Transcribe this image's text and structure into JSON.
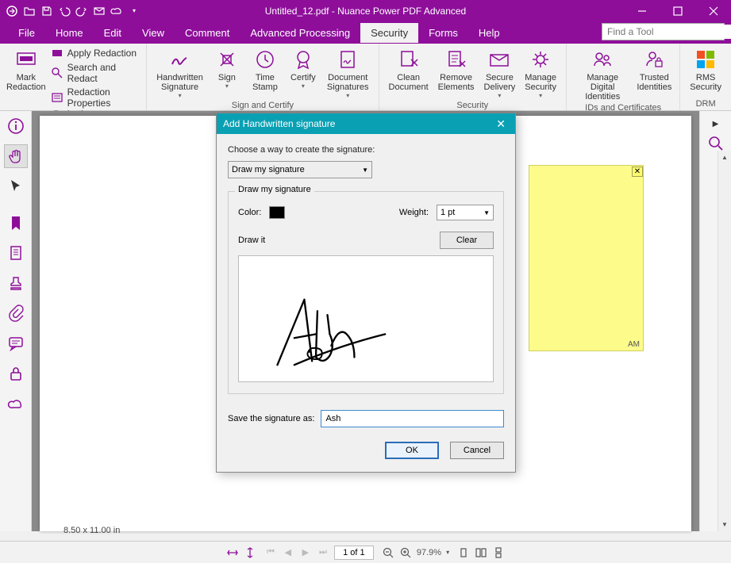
{
  "app": {
    "title": "Untitled_12.pdf - Nuance Power PDF Advanced"
  },
  "menu": {
    "file": "File",
    "home": "Home",
    "edit": "Edit",
    "view": "View",
    "comment": "Comment",
    "advanced": "Advanced Processing",
    "security": "Security",
    "forms": "Forms",
    "help": "Help"
  },
  "find_placeholder": "Find a Tool",
  "ribbon": {
    "redaction": {
      "label": "Redaction",
      "mark": "Mark\nRedaction",
      "apply": "Apply Redaction",
      "search": "Search and Redact",
      "props": "Redaction Properties"
    },
    "sign_certify": {
      "label": "Sign and Certify",
      "handwritten": "Handwritten\nSignature",
      "sign": "Sign",
      "time": "Time\nStamp",
      "certify": "Certify",
      "docsig": "Document\nSignatures"
    },
    "security": {
      "label": "Security",
      "clean": "Clean\nDocument",
      "remove": "Remove\nElements",
      "secure": "Secure\nDelivery",
      "manage": "Manage\nSecurity"
    },
    "ids": {
      "label": "IDs and Certificates",
      "digital": "Manage Digital\nIdentities",
      "trusted": "Trusted\nIdentities"
    },
    "drm": {
      "label": "DRM",
      "rms": "RMS\nSecurity"
    }
  },
  "note": {
    "timestamp": "AM"
  },
  "dialog": {
    "title": "Add Handwritten signature",
    "choose": "Choose a way to create the signature:",
    "method": "Draw my signature",
    "group_title": "Draw my signature",
    "color_label": "Color:",
    "weight_label": "Weight:",
    "weight_val": "1 pt",
    "draw_it": "Draw it",
    "clear": "Clear",
    "save_label": "Save the signature as:",
    "save_value": "Ash",
    "ok": "OK",
    "cancel": "Cancel"
  },
  "status": {
    "page_size": "8.50 x 11.00 in",
    "page": "1 of 1",
    "zoom": "97.9%"
  }
}
